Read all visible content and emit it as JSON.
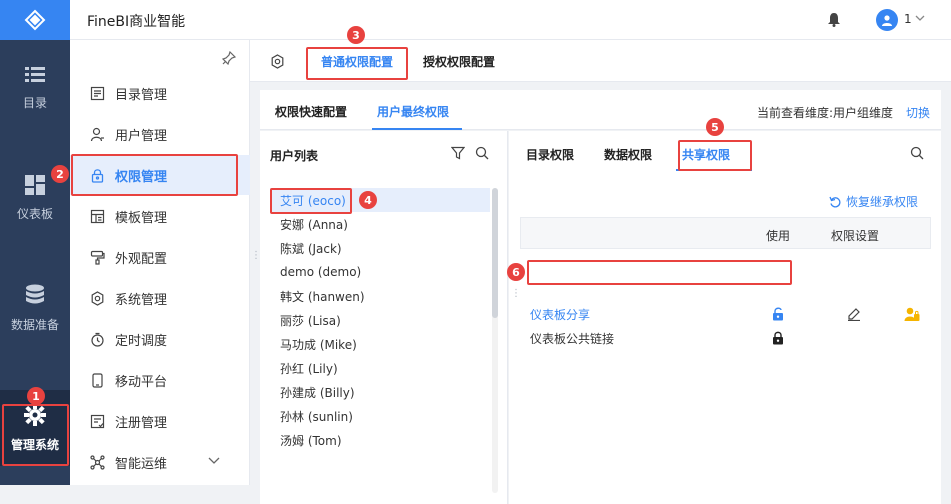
{
  "app": {
    "title": "FineBI商业智能"
  },
  "user": {
    "name": "1"
  },
  "rail": {
    "items": [
      {
        "label": "目录",
        "icon": "list-icon"
      },
      {
        "label": "仪表板",
        "icon": "dashboard-icon"
      },
      {
        "label": "数据准备",
        "icon": "database-icon"
      },
      {
        "label": "管理系统",
        "icon": "gear-icon"
      }
    ]
  },
  "sidebar": {
    "items": [
      {
        "label": "目录管理",
        "icon": "catalog-icon"
      },
      {
        "label": "用户管理",
        "icon": "user-icon"
      },
      {
        "label": "权限管理",
        "icon": "lock-icon"
      },
      {
        "label": "模板管理",
        "icon": "template-icon"
      },
      {
        "label": "外观配置",
        "icon": "brush-icon"
      },
      {
        "label": "系统管理",
        "icon": "settings-icon"
      },
      {
        "label": "定时调度",
        "icon": "timer-icon"
      },
      {
        "label": "移动平台",
        "icon": "mobile-icon"
      },
      {
        "label": "注册管理",
        "icon": "register-icon"
      },
      {
        "label": "智能运维",
        "icon": "ops-icon"
      }
    ]
  },
  "top_tabs": [
    "普通权限配置",
    "授权权限配置"
  ],
  "sub_tabs": [
    "权限快速配置",
    "用户最终权限"
  ],
  "dimension": {
    "label": "当前查看维度:用户组维度",
    "switch": "切换"
  },
  "user_list": {
    "title": "用户列表",
    "users": [
      "艾可 (eoco)",
      "安娜 (Anna)",
      "陈斌 (Jack)",
      "demo (demo)",
      "韩文 (hanwen)",
      "丽莎 (Lisa)",
      "马功成 (Mike)",
      "孙红 (Lily)",
      "孙建成 (Billy)",
      "孙林 (sunlin)",
      "汤姆 (Tom)"
    ]
  },
  "perm_tabs": [
    "目录权限",
    "数据权限",
    "共享权限"
  ],
  "restore": "恢复继承权限",
  "table": {
    "headers": [
      "使用",
      "权限设置"
    ],
    "rows": [
      {
        "name": "仪表板分享"
      },
      {
        "name": "仪表板公共链接"
      }
    ]
  },
  "badges": [
    "1",
    "2",
    "3",
    "4",
    "5",
    "6"
  ],
  "colors": {
    "accent": "#3685f2",
    "highlight": "#e8423f",
    "rail": "#2c3e5c"
  }
}
